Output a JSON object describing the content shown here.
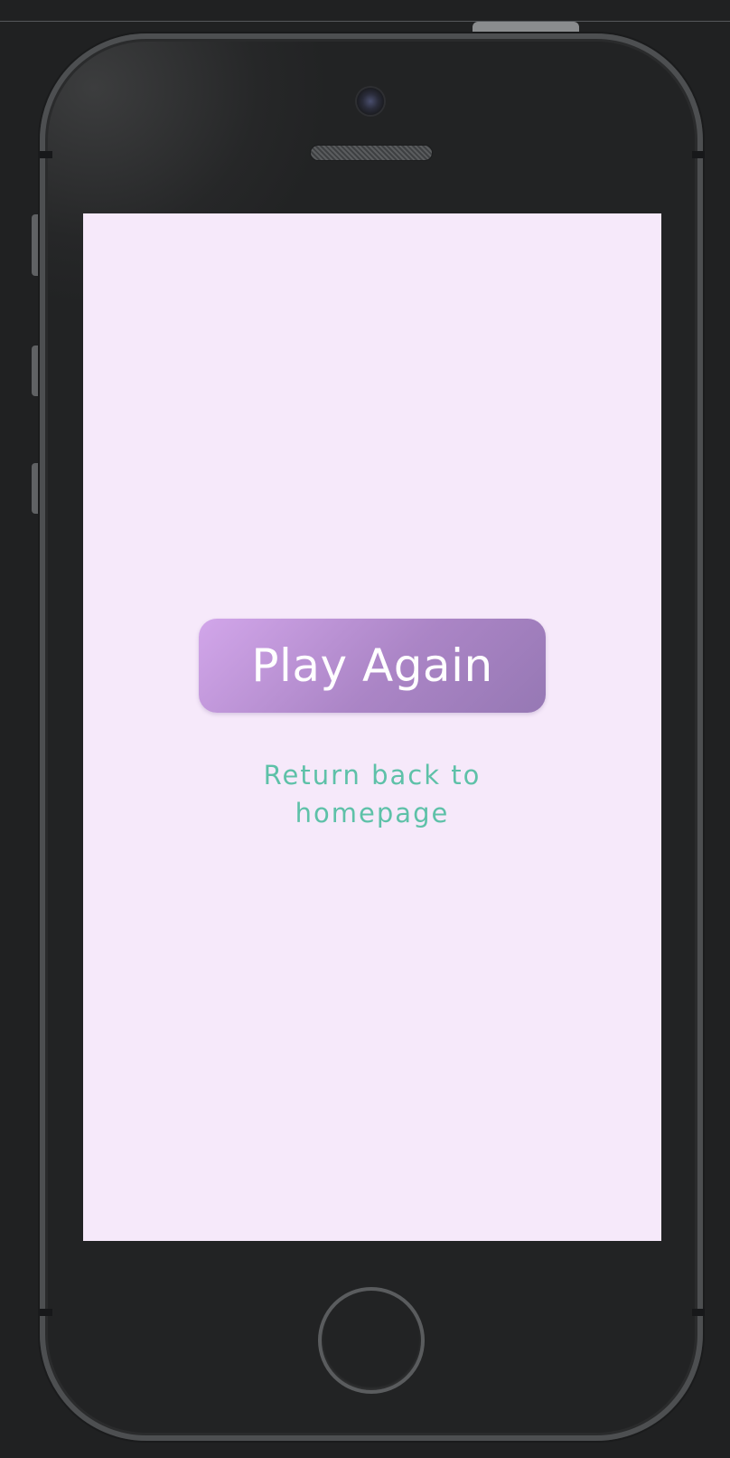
{
  "screen": {
    "play_again_label": "Play Again",
    "return_link_label": "Return back to homepage"
  },
  "colors": {
    "screen_background": "#f6e9fa",
    "button_gradient_start": "#d2a6ea",
    "button_gradient_end": "#9678b4",
    "link_color": "#5ec1a8",
    "device_body": "#222324"
  },
  "icons": {
    "device": "phone-frame",
    "camera": "camera-icon",
    "speaker": "speaker-grille-icon",
    "home": "home-button-icon"
  }
}
